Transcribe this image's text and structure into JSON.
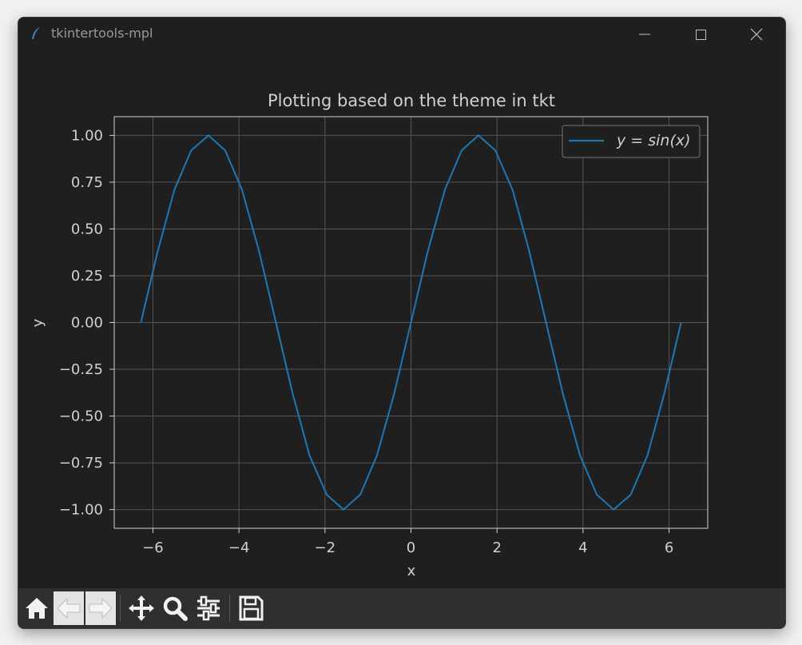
{
  "window": {
    "title": "tkintertools-mpl",
    "app_icon": "feather-icon",
    "controls": [
      "minimize-icon",
      "maximize-icon",
      "close-icon"
    ]
  },
  "chart_data": {
    "type": "line",
    "title": "Plotting based on the theme in tkt",
    "xlabel": "x",
    "ylabel": "y",
    "xlim": [
      -6.9,
      6.9
    ],
    "ylim": [
      -1.1,
      1.1
    ],
    "xticks": [
      -6,
      -4,
      -2,
      0,
      2,
      4,
      6
    ],
    "xtick_labels": [
      "−6",
      "−4",
      "−2",
      "0",
      "2",
      "4",
      "6"
    ],
    "yticks": [
      1.0,
      0.75,
      0.5,
      0.25,
      0.0,
      -0.25,
      -0.5,
      -0.75,
      -1.0
    ],
    "ytick_labels": [
      "1.00",
      "0.75",
      "0.50",
      "0.25",
      "0.00",
      "−0.25",
      "−0.50",
      "−0.75",
      "−1.00"
    ],
    "grid": true,
    "legend_position": "upper-right",
    "series": [
      {
        "name": "y = sin(x)",
        "color": "#1f77b4",
        "x": [
          -6.28,
          -5.89,
          -5.5,
          -5.11,
          -4.71,
          -4.32,
          -3.93,
          -3.53,
          -3.14,
          -2.75,
          -2.36,
          -1.96,
          -1.57,
          -1.18,
          -0.79,
          -0.39,
          0.0,
          0.39,
          0.79,
          1.18,
          1.57,
          1.96,
          2.36,
          2.75,
          3.14,
          3.53,
          3.93,
          4.32,
          4.71,
          5.11,
          5.5,
          5.89,
          6.28
        ],
        "y": [
          0.0,
          0.38,
          0.71,
          0.92,
          1.0,
          0.92,
          0.71,
          0.38,
          0.0,
          -0.38,
          -0.71,
          -0.92,
          -1.0,
          -0.92,
          -0.71,
          -0.38,
          0.0,
          0.38,
          0.71,
          0.92,
          1.0,
          0.92,
          0.71,
          0.38,
          0.0,
          -0.38,
          -0.71,
          -0.92,
          -1.0,
          -0.92,
          -0.71,
          -0.38,
          0.0
        ]
      }
    ],
    "colors": {
      "background": "#1f1f1f",
      "text": "#d0d0d0",
      "grid": "#555555",
      "line": "#1f77b4"
    }
  },
  "toolbar": {
    "buttons": [
      "home-icon",
      "back-icon",
      "forward-icon",
      "pan-icon",
      "zoom-icon",
      "configure-subplots-icon",
      "save-icon"
    ]
  }
}
